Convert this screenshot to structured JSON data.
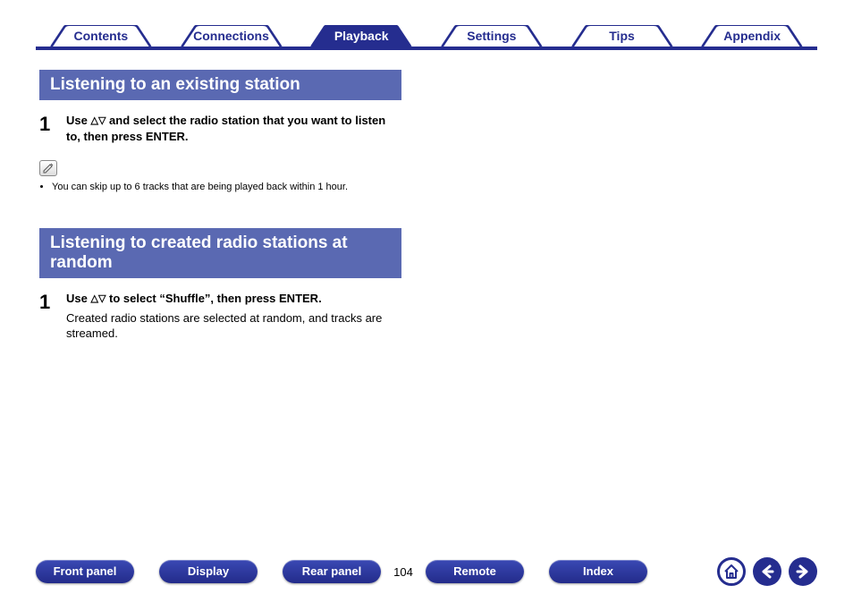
{
  "tabs": {
    "items": [
      {
        "label": "Contents",
        "active": false
      },
      {
        "label": "Connections",
        "active": false
      },
      {
        "label": "Playback",
        "active": true
      },
      {
        "label": "Settings",
        "active": false
      },
      {
        "label": "Tips",
        "active": false
      },
      {
        "label": "Appendix",
        "active": false
      }
    ]
  },
  "section1": {
    "title": "Listening to an existing station",
    "step_num": "1",
    "step_pre": "Use ",
    "step_post": " and select the radio station that you want to listen to, then press ENTER.",
    "note_bullet": "You can skip up to 6 tracks that are being played back within 1 hour."
  },
  "section2": {
    "title": "Listening to created radio stations at random",
    "step_num": "1",
    "step_pre": "Use ",
    "step_post": " to select “Shuffle”, then press ENTER.",
    "step_sub": "Created radio stations are selected at random, and tracks are streamed."
  },
  "bottom": {
    "front": "Front panel",
    "display": "Display",
    "rear": "Rear panel",
    "page": "104",
    "remote": "Remote",
    "index": "Index"
  },
  "glyph": {
    "up": "△",
    "down": "▽"
  }
}
